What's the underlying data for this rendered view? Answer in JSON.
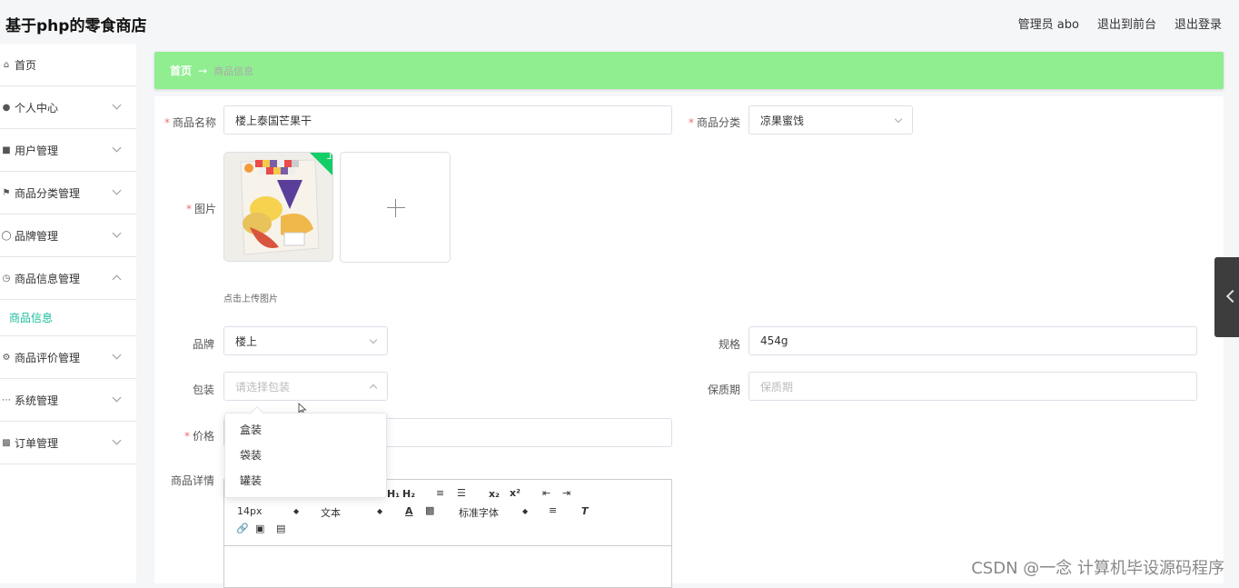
{
  "header": {
    "site_title": "基于php的零食商店",
    "nav": [
      "管理员 abo",
      "退出到前台",
      "退出登录"
    ]
  },
  "sidebar": {
    "items": [
      {
        "label": "首页",
        "icon": "home-icon",
        "expandable": false
      },
      {
        "label": "个人中心",
        "icon": "user-icon",
        "expandable": true
      },
      {
        "label": "用户管理",
        "icon": "users-icon",
        "expandable": true
      },
      {
        "label": "商品分类管理",
        "icon": "flag-icon",
        "expandable": true
      },
      {
        "label": "品牌管理",
        "icon": "compass-icon",
        "expandable": true
      },
      {
        "label": "商品信息管理",
        "icon": "clock-icon",
        "expandable": true,
        "expanded": true
      },
      {
        "label": "商品评价管理",
        "icon": "settings-icon",
        "expandable": true
      },
      {
        "label": "系统管理",
        "icon": "ellipsis-icon",
        "expandable": true
      },
      {
        "label": "订单管理",
        "icon": "clipboard-icon",
        "expandable": true
      }
    ],
    "active_sub_item": "商品信息"
  },
  "breadcrumb": {
    "home": "首页",
    "separator": "→",
    "current": "商品信息"
  },
  "form": {
    "name_label": "商品名称",
    "name_value": "楼上泰国芒果干",
    "category_label": "商品分类",
    "category_value": "凉果蜜饯",
    "image_label": "图片",
    "upload_hint": "点击上传图片",
    "brand_label": "品牌",
    "brand_value": "楼上",
    "spec_label": "规格",
    "spec_value": "454g",
    "package_label": "包装",
    "package_placeholder": "请选择包装",
    "shelf_life_label": "保质期",
    "shelf_life_placeholder": "保质期",
    "price_label": "价格",
    "detail_label": "商品详情",
    "package_options": [
      "盒装",
      "袋装",
      "罐装"
    ]
  },
  "editor": {
    "font_size": "14px",
    "block_format": "文本",
    "font_family": "标准字体"
  },
  "watermark": "CSDN @一念 计算机毕设源码程序",
  "colors": {
    "breadcrumb_bg": "#90ee90",
    "active_sub": "#1abc9c",
    "required": "#f56c6c",
    "success_badge": "#13ce66"
  }
}
